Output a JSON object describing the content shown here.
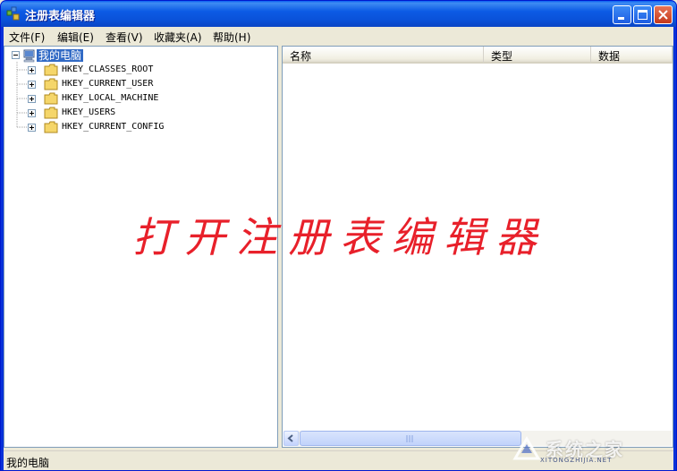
{
  "window": {
    "title": "注册表编辑器"
  },
  "menu": {
    "items": [
      {
        "label": "文件(F)"
      },
      {
        "label": "编辑(E)"
      },
      {
        "label": "查看(V)"
      },
      {
        "label": "收藏夹(A)"
      },
      {
        "label": "帮助(H)"
      }
    ]
  },
  "tree": {
    "root": {
      "label": "我的电脑",
      "icon": "computer-icon"
    },
    "keys": [
      {
        "label": "HKEY_CLASSES_ROOT",
        "icon": "folder-icon"
      },
      {
        "label": "HKEY_CURRENT_USER",
        "icon": "folder-icon"
      },
      {
        "label": "HKEY_LOCAL_MACHINE",
        "icon": "folder-icon"
      },
      {
        "label": "HKEY_USERS",
        "icon": "folder-icon"
      },
      {
        "label": "HKEY_CURRENT_CONFIG",
        "icon": "folder-icon"
      }
    ]
  },
  "list": {
    "columns": [
      {
        "label": "名称"
      },
      {
        "label": "类型"
      },
      {
        "label": "数据"
      }
    ]
  },
  "statusbar": {
    "text": "我的电脑"
  },
  "overlay": {
    "caption": "打开注册表编辑器"
  },
  "watermark": {
    "text": "系统之家",
    "sub": "XITONGZHIJIA.NET"
  },
  "colors": {
    "title_bar": "#0A51D8",
    "selection": "#316AC5",
    "caption_red": "#E8202A",
    "face": "#ECE9D8"
  }
}
